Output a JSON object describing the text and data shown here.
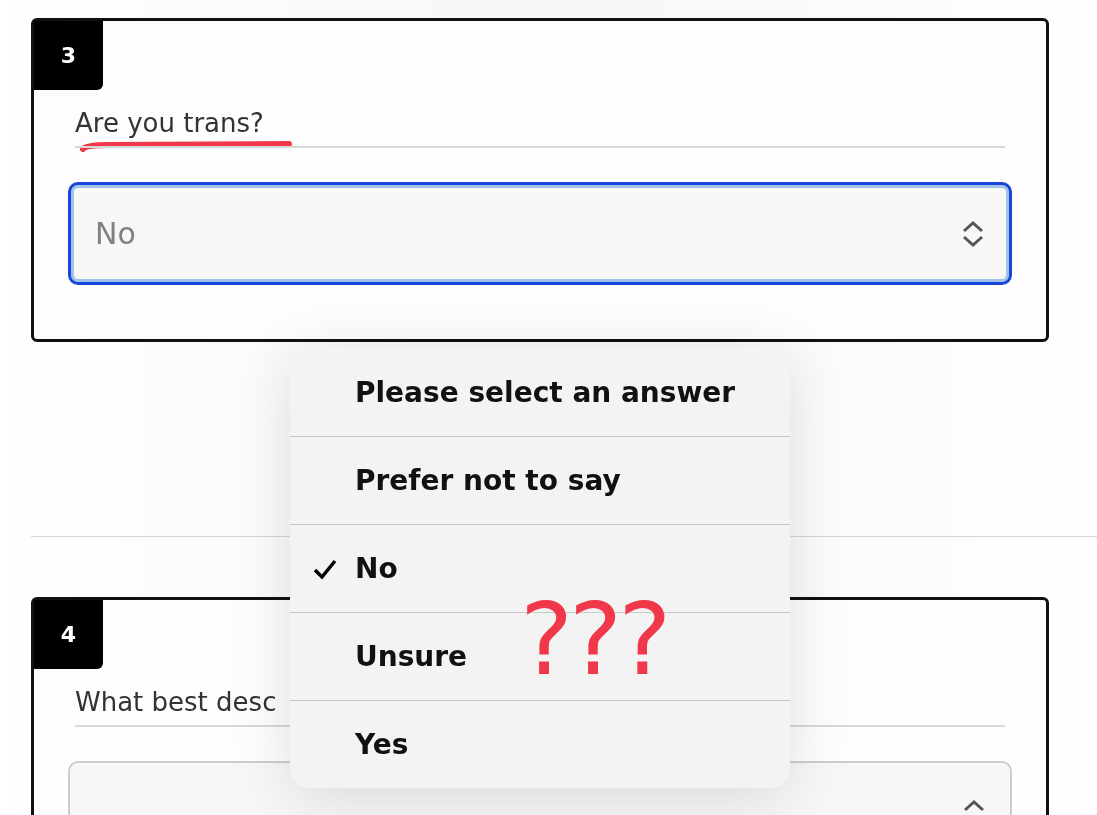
{
  "questions": [
    {
      "number": "3",
      "text": "Are you trans?",
      "select": {
        "value": "No",
        "focused": true
      }
    },
    {
      "number": "4",
      "text": "What best desc",
      "select": {
        "focused": false
      }
    }
  ],
  "dropdown": {
    "options": [
      {
        "label": "Please select an answer",
        "selected": false
      },
      {
        "label": "Prefer not to say",
        "selected": false
      },
      {
        "label": "No",
        "selected": true
      },
      {
        "label": "Unsure",
        "selected": false
      },
      {
        "label": "Yes",
        "selected": false
      }
    ]
  },
  "annotations": [
    {
      "kind": "underline",
      "color": "#f0384a"
    },
    {
      "kind": "text",
      "text": "???",
      "color": "#f0384a"
    }
  ]
}
